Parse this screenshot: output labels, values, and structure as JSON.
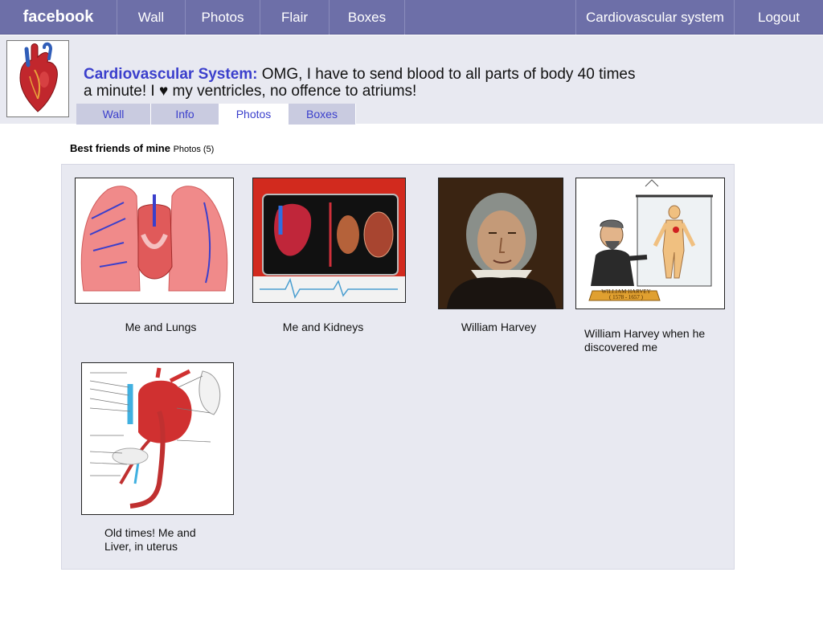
{
  "nav": {
    "brand": "facebook",
    "items": [
      "Wall",
      "Photos",
      "Flair",
      "Boxes"
    ],
    "profile_link": "Cardiovascular system",
    "logout": "Logout"
  },
  "profile": {
    "name": "Cardiovascular System:",
    "status_text": "OMG, I have to send blood to all parts of body  40 times a minute! I ",
    "heart_glyph": "♥",
    "status_tail": " my ventricles, no offence to atriums!"
  },
  "subtabs": [
    "Wall",
    "Info",
    "Photos",
    "Boxes"
  ],
  "album": {
    "title": "Best friends of mine",
    "count": "Photos (5)",
    "photos": [
      {
        "caption": "Me and Lungs",
        "icon": "lungs-heart-illustration"
      },
      {
        "caption": "Me and Kidneys",
        "icon": "heart-kidney-illustration"
      },
      {
        "caption": "William Harvey",
        "icon": "portrait-painting"
      },
      {
        "caption": "William Harvey when he discovered me",
        "icon": "harvey-cartoon",
        "banner": "WILLIAM HARVEY",
        "banner_dates": "( 1578 - 1657 )"
      },
      {
        "caption": "Old times! Me and Liver, in uterus",
        "icon": "fetal-circulation-diagram"
      }
    ]
  }
}
